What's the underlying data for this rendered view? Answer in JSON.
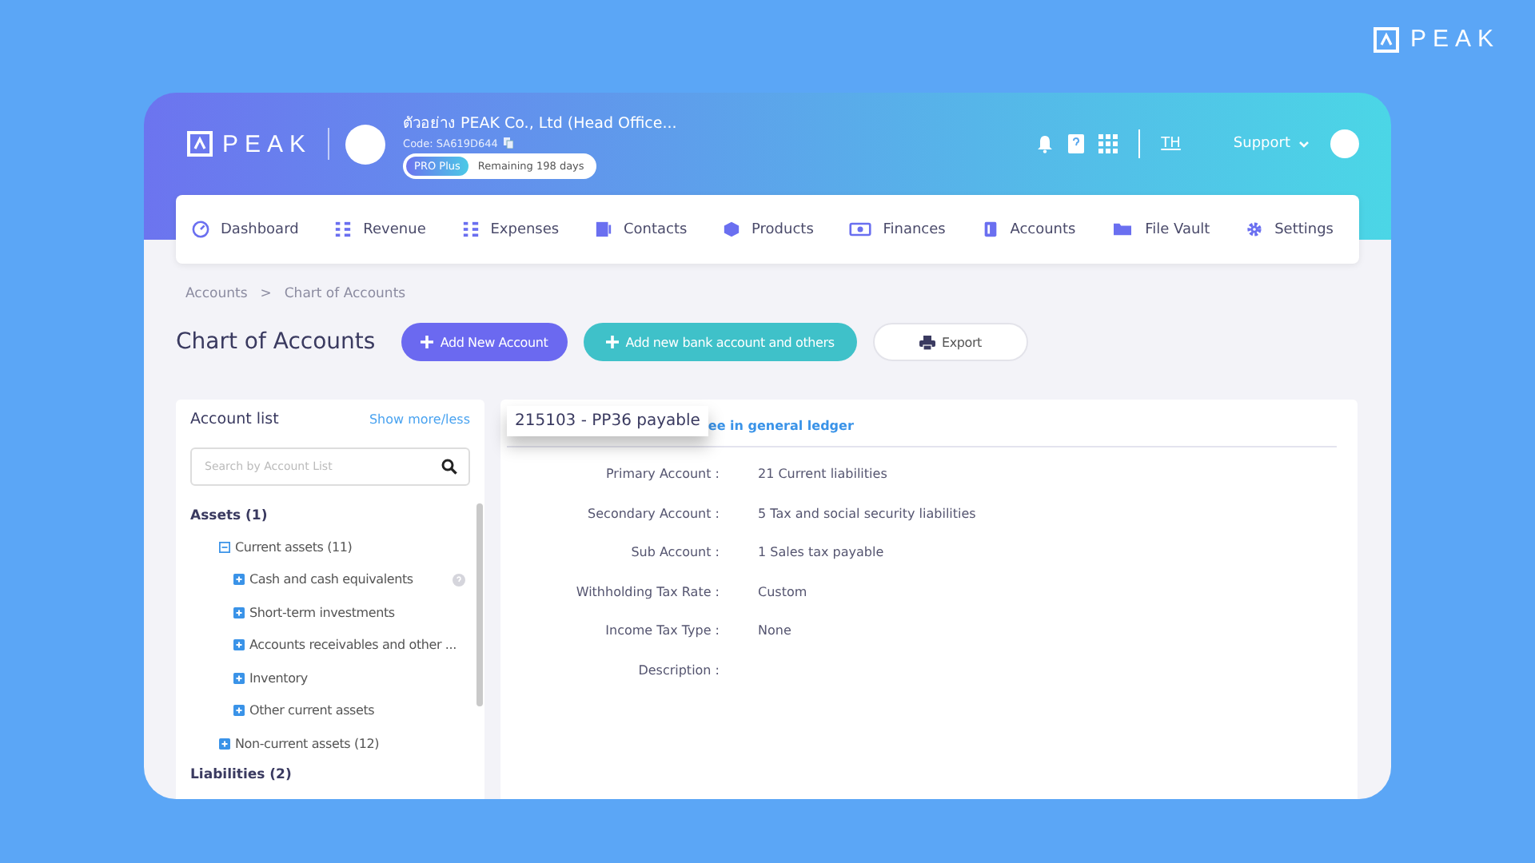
{
  "brand": {
    "logo": "PEAK"
  },
  "header": {
    "company_logo": "PEAK",
    "company_name": "ตัวอย่าง PEAK Co., Ltd (Head Office...",
    "code": "Code: SA619D644",
    "plan": "PRO Plus",
    "remaining": "Remaining 198 days",
    "language": "TH",
    "support": "Support"
  },
  "nav": [
    {
      "label": "Dashboard"
    },
    {
      "label": "Revenue"
    },
    {
      "label": "Expenses"
    },
    {
      "label": "Contacts"
    },
    {
      "label": "Products"
    },
    {
      "label": "Finances"
    },
    {
      "label": "Accounts"
    },
    {
      "label": "File Vault"
    },
    {
      "label": "Settings"
    }
  ],
  "breadcrumb": [
    "Accounts",
    ">",
    "Chart of Accounts"
  ],
  "page_title": "Chart of Accounts",
  "actions": [
    {
      "label": "Add New Account",
      "kind": "primary"
    },
    {
      "label": "Add new bank account and others",
      "kind": "teal"
    },
    {
      "label": "Export",
      "kind": "export"
    }
  ],
  "account_list": {
    "title": "Account list",
    "toggle": "Show more/less",
    "search_placeholder": "Search by Account List",
    "tree": [
      {
        "label": "Assets (1)",
        "children": [
          {
            "label": "Current assets (11)",
            "expanded": true,
            "children": [
              {
                "label": "Cash and cash equivalents",
                "expanded": false,
                "help": true
              },
              {
                "label": "Short-term investments",
                "expanded": false,
                "help": false
              },
              {
                "label": "Accounts receivables and other ...",
                "expanded": false,
                "help": false
              },
              {
                "label": "Inventory",
                "expanded": false,
                "help": false
              },
              {
                "label": "Other current assets",
                "expanded": false,
                "help": false
              }
            ]
          },
          {
            "label": "Non-current assets (12)",
            "expanded": false
          }
        ]
      },
      {
        "label": "Liabilities (2)"
      }
    ]
  },
  "detail": {
    "title": "215103 - PP36 payable",
    "ledger_link": "ee in general ledger",
    "fields": [
      {
        "label": "Primary Account :",
        "value": "21 Current liabilities"
      },
      {
        "label": "Secondary Account :",
        "value": "5 Tax and social security liabilities"
      },
      {
        "label": "Sub Account :",
        "value": "1 Sales tax payable"
      },
      {
        "label": "Withholding Tax Rate :",
        "value": "Custom"
      },
      {
        "label": "Income Tax Type :",
        "value": "None"
      },
      {
        "label": "Description :"
      }
    ]
  }
}
